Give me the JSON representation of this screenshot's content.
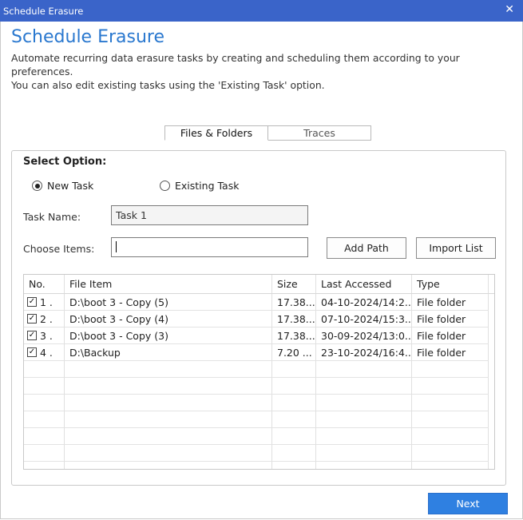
{
  "window": {
    "title": "Schedule Erasure",
    "close_glyph": "✕"
  },
  "header": {
    "heading": "Schedule Erasure",
    "description_line1": "Automate recurring data erasure tasks by creating and scheduling them according to your preferences.",
    "description_line2": "You can also edit existing tasks using the 'Existing Task' option."
  },
  "tabs": [
    {
      "label": "Files & Folders",
      "active": true
    },
    {
      "label": "Traces",
      "active": false
    }
  ],
  "form": {
    "select_option_label": "Select Option:",
    "radio_new": "New Task",
    "radio_existing": "Existing Task",
    "selected_radio": "new",
    "task_name_label": "Task Name:",
    "task_name_value": "Task 1",
    "choose_items_label": "Choose Items:",
    "choose_items_value": "",
    "add_path_label": "Add Path",
    "import_list_label": "Import List"
  },
  "table": {
    "columns": [
      "No.",
      "File Item",
      "Size",
      "Last Accessed",
      "Type"
    ],
    "rows": [
      {
        "no": "1 .",
        "item": "D:\\boot 3 - Copy (5)",
        "size": "17.38...",
        "accessed": "04-10-2024/14:2...",
        "type": "File folder",
        "checked": true
      },
      {
        "no": "2 .",
        "item": "D:\\boot 3 - Copy (4)",
        "size": "17.38...",
        "accessed": "07-10-2024/15:3...",
        "type": "File folder",
        "checked": true
      },
      {
        "no": "3 .",
        "item": "D:\\boot 3 - Copy (3)",
        "size": "17.38...",
        "accessed": "30-09-2024/13:0...",
        "type": "File folder",
        "checked": true
      },
      {
        "no": "4 .",
        "item": "D:\\Backup",
        "size": "7.20 ...",
        "accessed": "23-10-2024/16:4...",
        "type": "File folder",
        "checked": true
      }
    ]
  },
  "footer": {
    "next_label": "Next"
  },
  "colors": {
    "titlebar": "#3a64c9",
    "heading": "#2a78cf",
    "next_button": "#2f80e1"
  }
}
